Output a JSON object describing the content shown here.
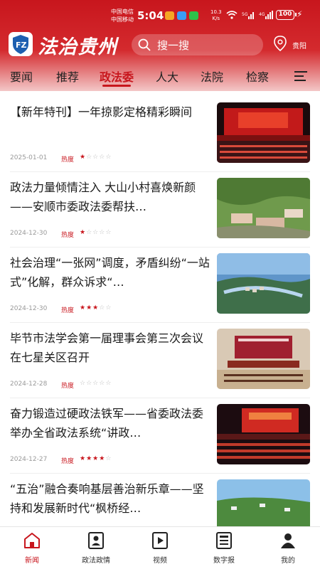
{
  "status": {
    "carrier1": "中国电信",
    "carrier2": "中国移动",
    "time": "5:04",
    "speed_value": "10.3",
    "speed_unit": "K/s",
    "battery": "100"
  },
  "header": {
    "brand": "法治贵州",
    "search_placeholder": "搜一搜",
    "location": "贵阳"
  },
  "tabs": [
    "要闻",
    "推荐",
    "政法委",
    "人大",
    "法院",
    "检察"
  ],
  "active_tab": "政法委",
  "heat_label": "热度",
  "news": [
    {
      "title": "【新年特刊】一年掠影定格精彩瞬间",
      "date": "2025-01-01",
      "rating": 1
    },
    {
      "title": "政法力量倾情注入 大山小村喜焕新颜 ——安顺市委政法委帮扶…",
      "date": "2024-12-30",
      "rating": 1
    },
    {
      "title": "社会治理“一张网”调度，矛盾纠纷“一站式”化解，群众诉求“…",
      "date": "2024-12-30",
      "rating": 3
    },
    {
      "title": "毕节市法学会第一届理事会第三次会议在七星关区召开",
      "date": "2024-12-28",
      "rating": 0
    },
    {
      "title": "奋力锻造过硬政法铁军——省委政法委举办全省政法系统“讲政…",
      "date": "2024-12-27",
      "rating": 4
    },
    {
      "title": "“五治”融合奏响基层善治新乐章——坚持和发展新时代“枫桥经…",
      "date": "",
      "rating": 0
    }
  ],
  "bottom_nav": [
    {
      "label": "新闻",
      "icon": "home-icon"
    },
    {
      "label": "政法政情",
      "icon": "contact-card-icon"
    },
    {
      "label": "视频",
      "icon": "video-play-icon"
    },
    {
      "label": "数字报",
      "icon": "newspaper-icon"
    },
    {
      "label": "我的",
      "icon": "user-icon"
    }
  ],
  "active_nav": "新闻",
  "colors": {
    "brand_red": "#c8161d"
  }
}
